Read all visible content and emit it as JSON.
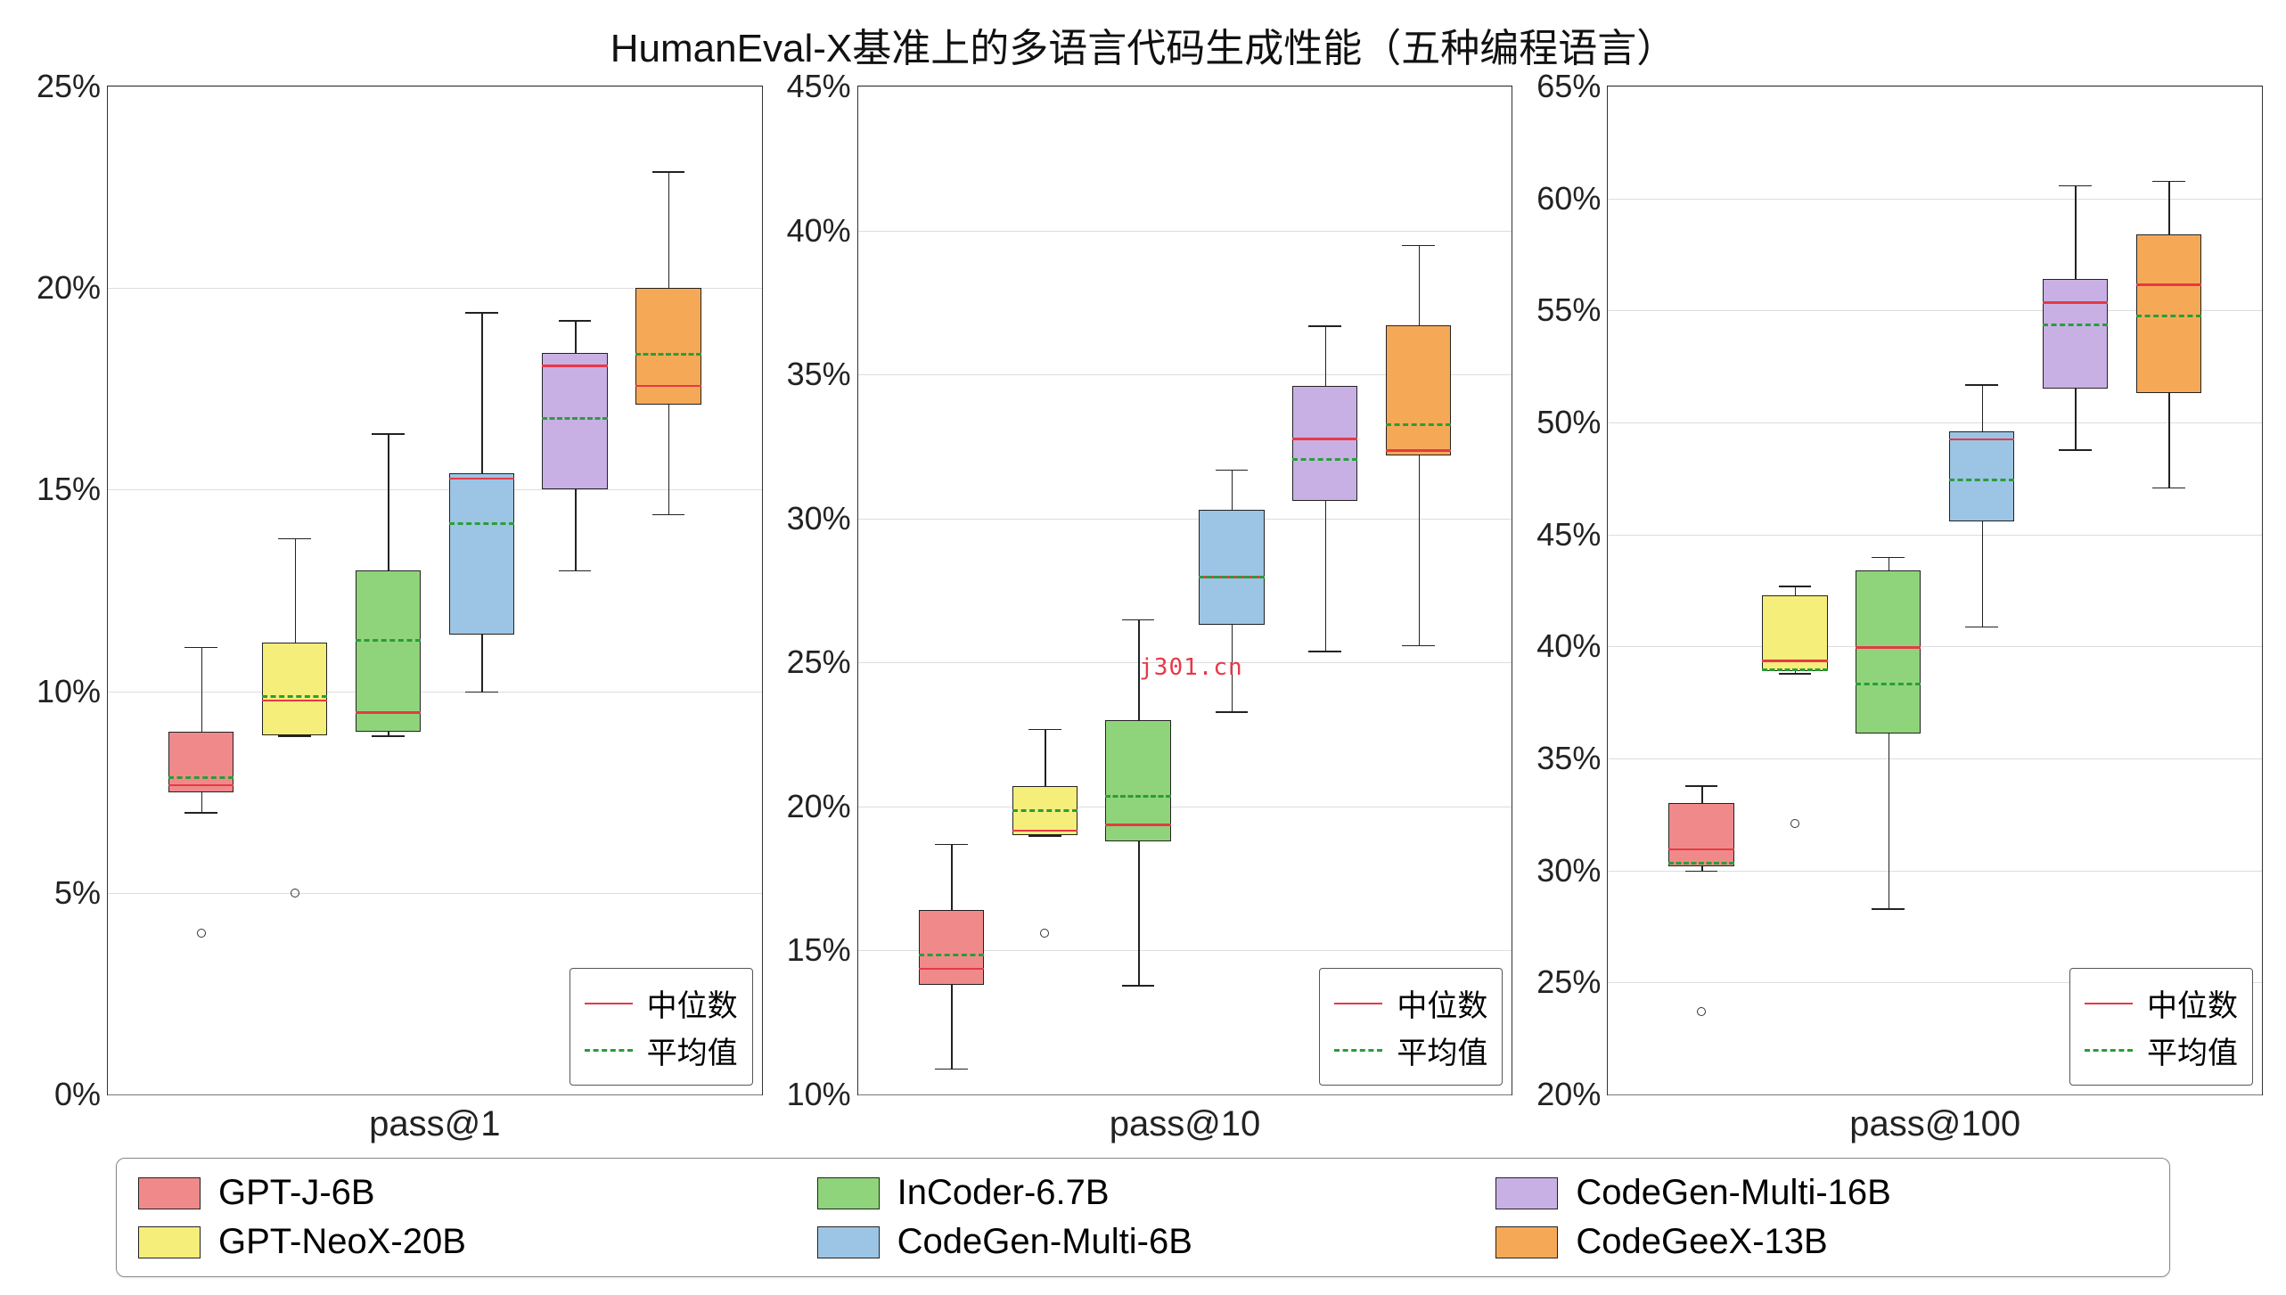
{
  "title": "HumanEval-X基准上的多语言代码生成性能（五种编程语言）",
  "watermark": "j301.cn",
  "inset_legend": {
    "median": "中位数",
    "mean": "平均值"
  },
  "colors": {
    "GPT-J-6B": "#f08a8a",
    "GPT-NeoX-20B": "#f5ee7a",
    "InCoder-6.7B": "#8fd47a",
    "CodeGen-Multi-6B": "#9cc4e4",
    "CodeGen-Multi-16B": "#c9b0e4",
    "CodeGeeX-13B": "#f5a957"
  },
  "models": [
    "GPT-J-6B",
    "GPT-NeoX-20B",
    "InCoder-6.7B",
    "CodeGen-Multi-6B",
    "CodeGen-Multi-16B",
    "CodeGeeX-13B"
  ],
  "chart_data": [
    {
      "xlabel": "pass@1",
      "ylim": [
        0,
        25
      ],
      "yticks": [
        0,
        5,
        10,
        15,
        20,
        25
      ],
      "boxes": [
        {
          "model": "GPT-J-6B",
          "q1": 7.5,
          "median": 7.7,
          "mean": 7.9,
          "q3": 9.0,
          "wlo": 7.0,
          "whi": 11.1,
          "outliers": [
            4.0
          ]
        },
        {
          "model": "GPT-NeoX-20B",
          "q1": 8.9,
          "median": 9.8,
          "mean": 9.9,
          "q3": 11.2,
          "wlo": 8.9,
          "whi": 13.8,
          "outliers": [
            5.0
          ]
        },
        {
          "model": "InCoder-6.7B",
          "q1": 9.0,
          "median": 9.5,
          "mean": 11.3,
          "q3": 13.0,
          "wlo": 8.9,
          "whi": 16.4,
          "outliers": []
        },
        {
          "model": "CodeGen-Multi-6B",
          "q1": 11.4,
          "median": 15.3,
          "mean": 14.2,
          "q3": 15.4,
          "wlo": 10.0,
          "whi": 19.4,
          "outliers": []
        },
        {
          "model": "CodeGen-Multi-16B",
          "q1": 15.0,
          "median": 18.1,
          "mean": 16.8,
          "q3": 18.4,
          "wlo": 13.0,
          "whi": 19.2,
          "outliers": []
        },
        {
          "model": "CodeGeeX-13B",
          "q1": 17.1,
          "median": 17.6,
          "mean": 18.4,
          "q3": 20.0,
          "wlo": 14.4,
          "whi": 22.9,
          "outliers": []
        }
      ]
    },
    {
      "xlabel": "pass@10",
      "ylim": [
        10,
        45
      ],
      "yticks": [
        10,
        15,
        20,
        25,
        30,
        35,
        40,
        45
      ],
      "boxes": [
        {
          "model": "GPT-J-6B",
          "q1": 13.8,
          "median": 14.4,
          "mean": 14.9,
          "q3": 16.4,
          "wlo": 10.9,
          "whi": 18.7,
          "outliers": []
        },
        {
          "model": "GPT-NeoX-20B",
          "q1": 19.0,
          "median": 19.2,
          "mean": 19.9,
          "q3": 20.7,
          "wlo": 19.0,
          "whi": 22.7,
          "outliers": [
            15.6
          ]
        },
        {
          "model": "InCoder-6.7B",
          "q1": 18.8,
          "median": 19.4,
          "mean": 20.4,
          "q3": 23.0,
          "wlo": 13.8,
          "whi": 26.5,
          "outliers": []
        },
        {
          "model": "CodeGen-Multi-6B",
          "q1": 26.3,
          "median": 28.0,
          "mean": 28.0,
          "q3": 30.3,
          "wlo": 23.3,
          "whi": 31.7,
          "outliers": []
        },
        {
          "model": "CodeGen-Multi-16B",
          "q1": 30.6,
          "median": 32.8,
          "mean": 32.1,
          "q3": 34.6,
          "wlo": 25.4,
          "whi": 36.7,
          "outliers": []
        },
        {
          "model": "CodeGeeX-13B",
          "q1": 32.2,
          "median": 32.4,
          "mean": 33.3,
          "q3": 36.7,
          "wlo": 25.6,
          "whi": 39.5,
          "outliers": []
        }
      ]
    },
    {
      "xlabel": "pass@100",
      "ylim": [
        20,
        65
      ],
      "yticks": [
        20,
        25,
        30,
        35,
        40,
        45,
        50,
        55,
        60,
        65
      ],
      "boxes": [
        {
          "model": "GPT-J-6B",
          "q1": 30.2,
          "median": 31.0,
          "mean": 30.4,
          "q3": 33.0,
          "wlo": 30.0,
          "whi": 33.8,
          "outliers": [
            23.7
          ]
        },
        {
          "model": "GPT-NeoX-20B",
          "q1": 38.9,
          "median": 39.4,
          "mean": 39.0,
          "q3": 42.3,
          "wlo": 38.8,
          "whi": 42.7,
          "outliers": [
            32.1
          ]
        },
        {
          "model": "InCoder-6.7B",
          "q1": 36.1,
          "median": 40.0,
          "mean": 38.4,
          "q3": 43.4,
          "wlo": 28.3,
          "whi": 44.0,
          "outliers": []
        },
        {
          "model": "CodeGen-Multi-6B",
          "q1": 45.6,
          "median": 49.3,
          "mean": 47.5,
          "q3": 49.6,
          "wlo": 40.9,
          "whi": 51.7,
          "outliers": []
        },
        {
          "model": "CodeGen-Multi-16B",
          "q1": 51.5,
          "median": 55.4,
          "mean": 54.4,
          "q3": 56.4,
          "wlo": 48.8,
          "whi": 60.6,
          "outliers": []
        },
        {
          "model": "CodeGeeX-13B",
          "q1": 51.3,
          "median": 56.2,
          "mean": 54.8,
          "q3": 58.4,
          "wlo": 47.1,
          "whi": 60.8,
          "outliers": []
        }
      ]
    }
  ]
}
